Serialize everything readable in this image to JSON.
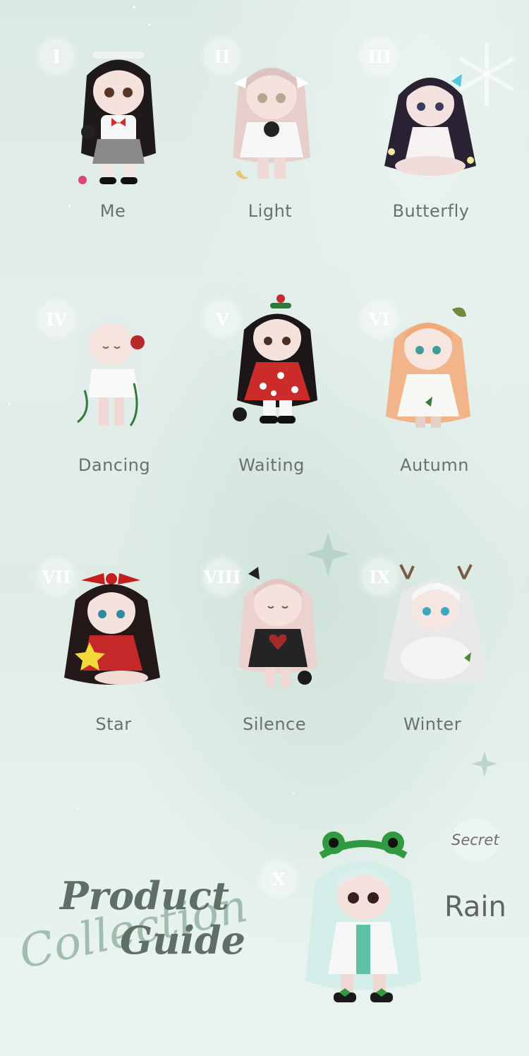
{
  "items": [
    {
      "numeral": "I",
      "name": "Me"
    },
    {
      "numeral": "II",
      "name": "Light"
    },
    {
      "numeral": "III",
      "name": "Butterfly"
    },
    {
      "numeral": "IV",
      "name": "Dancing"
    },
    {
      "numeral": "V",
      "name": "Waiting"
    },
    {
      "numeral": "VI",
      "name": "Autumn"
    },
    {
      "numeral": "VII",
      "name": "Star"
    },
    {
      "numeral": "VIII",
      "name": "Silence"
    },
    {
      "numeral": "IX",
      "name": "Winter"
    }
  ],
  "secret_item": {
    "numeral": "X",
    "tag": "Secret",
    "name": "Rain"
  },
  "heading": {
    "script": "Collection",
    "line1": "Product",
    "line2": "Guide"
  },
  "colors": {
    "background": "#dfece6",
    "label_text": "#6b6f6e",
    "heading_text": "#5e6f66",
    "script_text": "#7aa08c"
  }
}
